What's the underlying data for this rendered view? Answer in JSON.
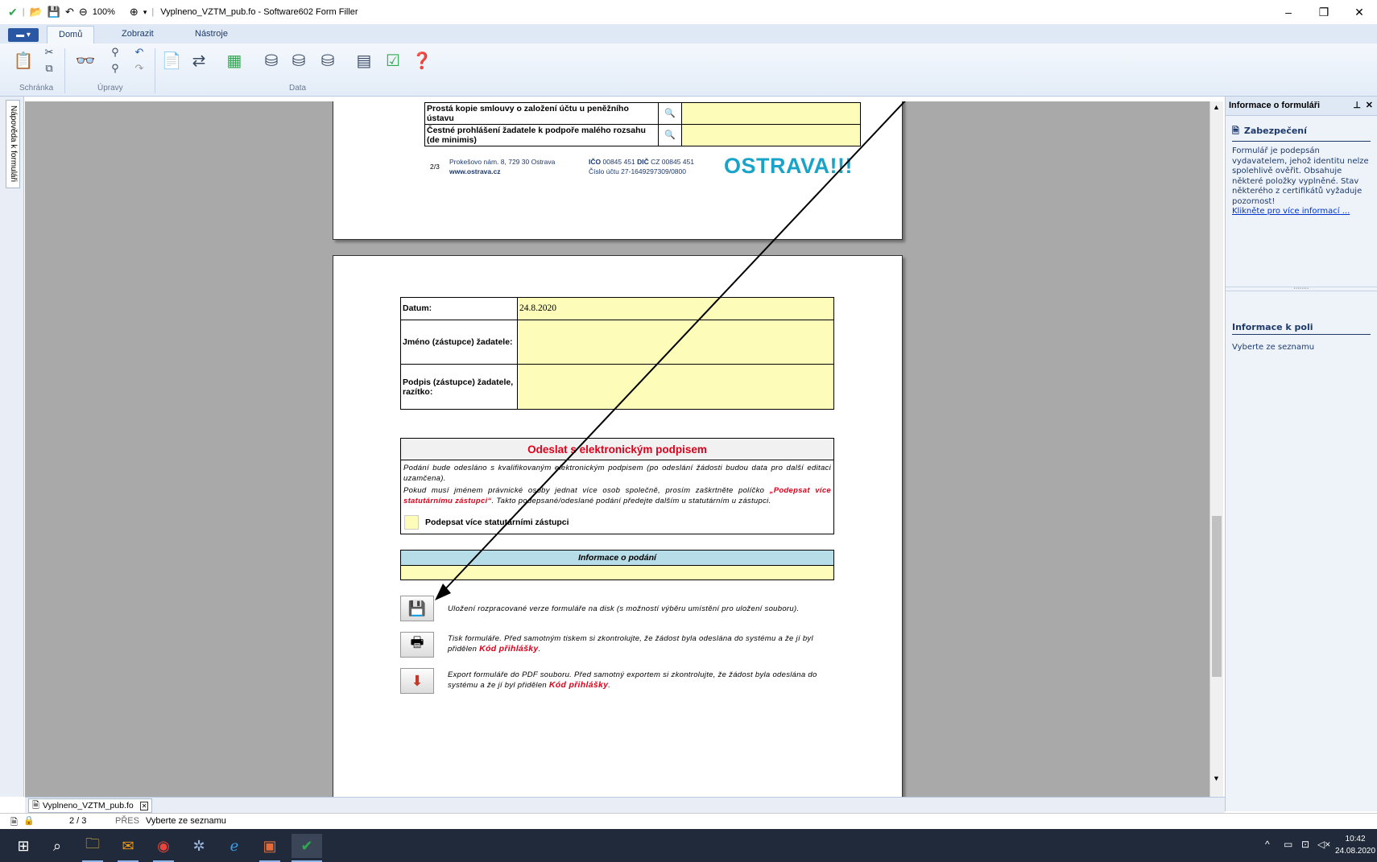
{
  "window": {
    "zoom": "100%",
    "title": "Vyplneno_VZTM_pub.fo - Software602 Form Filler",
    "minimize": "–",
    "restore": "❐",
    "close": "✕"
  },
  "tabs": [
    "Domů",
    "Zobrazit",
    "Nástroje"
  ],
  "ribbon_groups": {
    "clipboard": "Schránka",
    "edits": "Úpravy",
    "data": "Data"
  },
  "left_tab": "Nápověda k formuláři",
  "page1": {
    "rows": [
      "Prostá kopie smlouvy o založení účtu u peněžního ústavu",
      "Čestné prohlášení žadatele k podpoře malého rozsahu (de minimis)"
    ],
    "footer": {
      "page": "2/3",
      "address": "Prokešovo nám. 8, 729 30 Ostrava",
      "web": "www.ostrava.cz",
      "ico_label": "IČO",
      "ico": "00845 451",
      "dic_label": "DIČ",
      "dic": "CZ 00845 451",
      "account": "Číslo účtu 27-1649297309/0800",
      "logo": "OSTRAVA!!!"
    }
  },
  "page2": {
    "date_label": "Datum:",
    "date_value": "24.8.2020",
    "name_label": "Jméno (zástupce) žadatele:",
    "sign_label": "Podpis (zástupce) žadatele, razítko:",
    "send_title": "Odeslat s elektronickým podpisem",
    "send_p1": "Podání bude odesláno s kvalifikovaným elektronickým podpisem (po odeslání žádosti budou data pro další editaci uzamčena).",
    "send_p2_a": "Pokud musí jménem právnické osoby jednat více osob společně, prosím zaškrtněte políčko ",
    "send_p2_red": "„Podepsat více statutárnímu zástupci“",
    "send_p2_b": ". Takto podepsané/odeslané podání předejte dalším u statutárním u zástupci.",
    "checkbox_label": "Podepsat více statutárními zástupci",
    "info_title": "Informace o podání",
    "save_text": "Uložení rozpracované verze formuláře na disk (s možností výběru umístění pro uložení souboru).",
    "print_text_a": "Tisk formuláře. Před samotným tiskem si zkontrolujte, že žádost byla odeslána do systému a že jí byl přidělen ",
    "print_text_red": "Kód přihlášky",
    "export_text_a": "Export formuláře do PDF souboru. Před samotný exportem si zkontrolujte, že žádost byla odeslána do systému a že jí byl přidělen ",
    "export_text_red": "Kód přihlášky",
    "dot": "."
  },
  "right_panel": {
    "header": "Informace o formuláři",
    "security_title": "Zabezpečení",
    "security_text": "Formulář je podepsán vydavatelem, jehož identitu nelze spolehlivě ověřit. Obsahuje některé položky vyplněné. Stav některého z certifikátů vyžaduje pozornost!",
    "security_link": "Klikněte pro více informací ...",
    "field_title": "Informace k poli",
    "field_text": "Vyberte ze seznamu"
  },
  "doc_tab": "Vyplneno_VZTM_pub.fo",
  "status": {
    "pages": "2 / 3",
    "mode": "PŘES",
    "hint": "Vyberte ze seznamu"
  },
  "clock": {
    "time": "10:42",
    "date": "24.08.2020"
  }
}
